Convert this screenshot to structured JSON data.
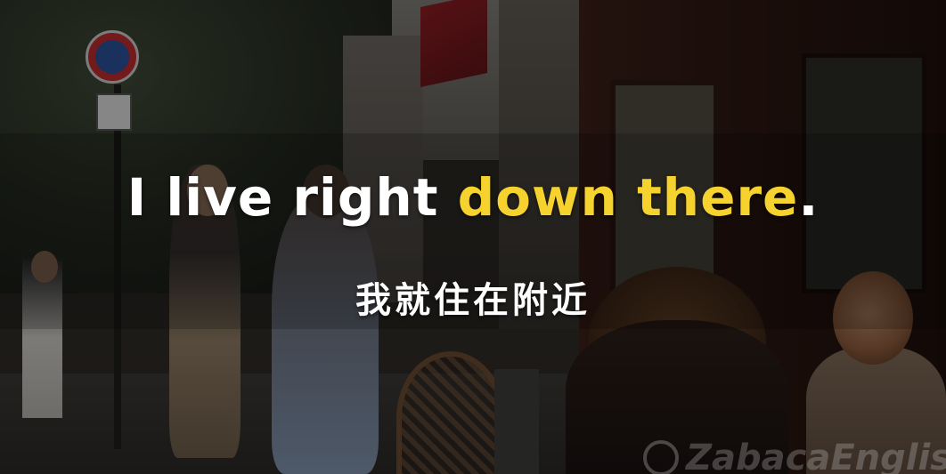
{
  "subtitle": {
    "english_plain": "I live right",
    "english_highlight": "down there",
    "english_end": ".",
    "chinese": "我就住在附近"
  },
  "watermark": {
    "symbol": "@",
    "text": "ZabacaEnglis"
  },
  "colors": {
    "subtitle_text": "#ffffff",
    "highlight": "#f6d22e"
  }
}
